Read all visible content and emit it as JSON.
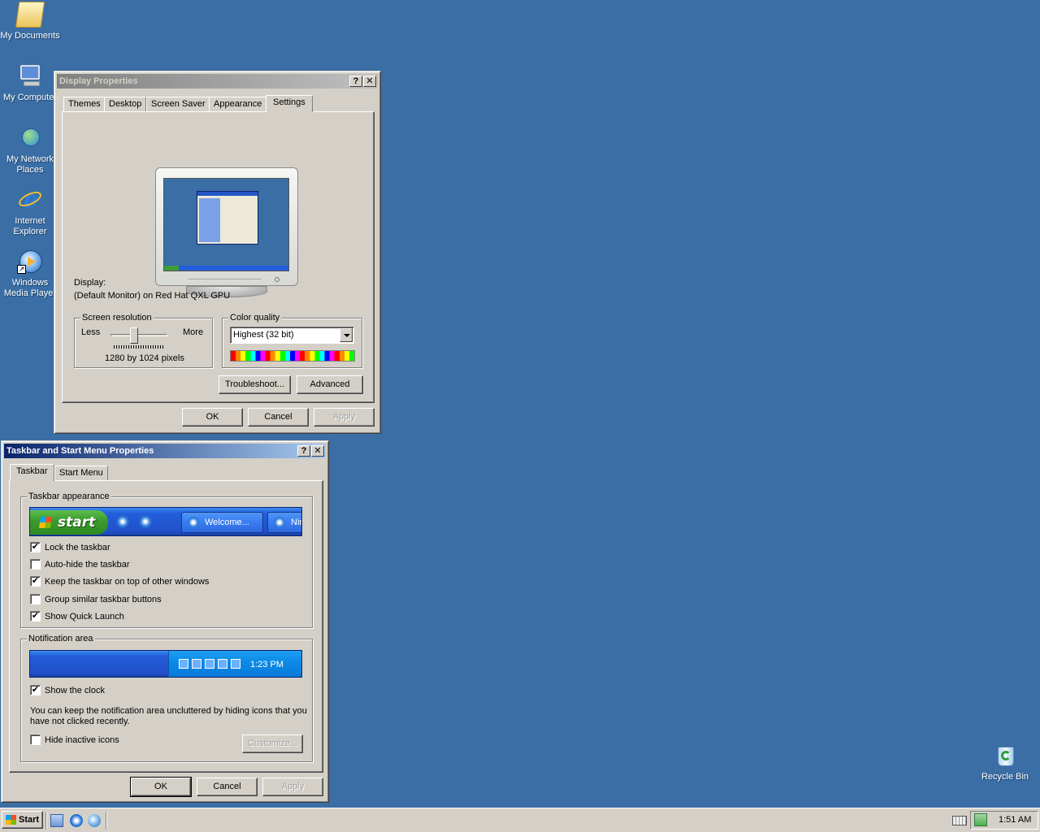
{
  "desktop": {
    "icons": [
      {
        "label": "My Documents",
        "icon": "folder-documents-icon"
      },
      {
        "label": "My Computer",
        "icon": "computer-icon"
      },
      {
        "label": "My Network Places",
        "icon": "network-places-icon"
      },
      {
        "label": "Internet Explorer",
        "icon": "internet-explorer-icon"
      },
      {
        "label": "Windows Media Player",
        "icon": "media-player-icon"
      },
      {
        "label": "Recycle Bin",
        "icon": "recycle-bin-icon"
      }
    ]
  },
  "display_props": {
    "title": "Display Properties",
    "help_label": "?",
    "close_label": "✕",
    "tabs": [
      "Themes",
      "Desktop",
      "Screen Saver",
      "Appearance",
      "Settings"
    ],
    "selected_tab": "Settings",
    "display_label": "Display:",
    "display_value": "(Default Monitor) on Red Hat QXL GPU",
    "resolution_group": "Screen resolution",
    "less_label": "Less",
    "more_label": "More",
    "resolution_value": "1280 by 1024 pixels",
    "resolution_slider_fraction": 0.4,
    "color_group": "Color quality",
    "color_value": "Highest (32 bit)",
    "troubleshoot_label": "Troubleshoot...",
    "advanced_label": "Advanced",
    "ok_label": "OK",
    "cancel_label": "Cancel",
    "apply_label": "Apply"
  },
  "taskbar_props": {
    "title": "Taskbar and Start Menu Properties",
    "help_label": "?",
    "close_label": "✕",
    "tabs": [
      "Taskbar",
      "Start Menu"
    ],
    "selected_tab": "Taskbar",
    "appearance_group": "Taskbar appearance",
    "preview": {
      "start_label": "start",
      "button1_label": "Welcome...",
      "button2_label": "Nin"
    },
    "options": [
      {
        "label": "Lock the taskbar",
        "checked": true
      },
      {
        "label": "Auto-hide the taskbar",
        "checked": false
      },
      {
        "label": "Keep the taskbar on top of other windows",
        "checked": true
      },
      {
        "label": "Group similar taskbar buttons",
        "checked": false
      },
      {
        "label": "Show Quick Launch",
        "checked": true
      }
    ],
    "notification_group": "Notification area",
    "tray_time": "1:23 PM",
    "show_clock_label": "Show the clock",
    "show_clock_checked": true,
    "hint_text_line1": "You can keep the notification area uncluttered by hiding icons that you",
    "hint_text_line2": "have not clicked recently.",
    "hide_inactive_label": "Hide inactive icons",
    "hide_inactive_checked": false,
    "customize_label": "Customize...",
    "ok_label": "OK",
    "cancel_label": "Cancel",
    "apply_label": "Apply"
  },
  "taskbar": {
    "start_label": "Start",
    "quick_launch": [
      "show-desktop-icon",
      "internet-explorer-icon",
      "media-player-icon"
    ],
    "clock": "1:51 AM"
  },
  "colors": {
    "desktop": "#3a6ea5",
    "active_title": "#0a246a",
    "inactive_title": "#808080",
    "face": "#d4d0c8"
  }
}
